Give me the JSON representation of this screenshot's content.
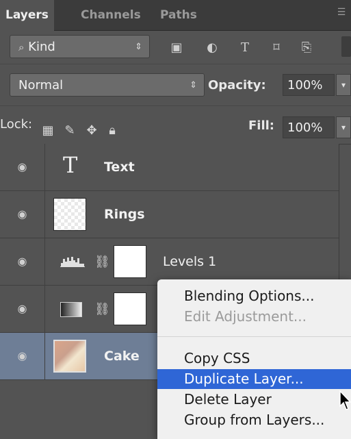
{
  "tabs": [
    {
      "label": "Layers"
    },
    {
      "label": "Channels"
    },
    {
      "label": "Paths"
    }
  ],
  "filter": {
    "kind_label": "Kind",
    "icons": [
      "pixel-filter-icon",
      "adjustment-filter-icon",
      "type-filter-icon",
      "shape-filter-icon",
      "smart-object-filter-icon"
    ]
  },
  "blend": {
    "mode": "Normal",
    "opacity_label": "Opacity:",
    "opacity_value": "100%"
  },
  "lock": {
    "label": "Lock:",
    "fill_label": "Fill:",
    "fill_value": "100%"
  },
  "layers": [
    {
      "name": "Text",
      "type": "text",
      "visible": true
    },
    {
      "name": "Rings",
      "type": "pixel",
      "visible": true
    },
    {
      "name": "Levels 1",
      "type": "levels-adjustment",
      "visible": true
    },
    {
      "name": "",
      "type": "gradient-map-adjustment",
      "visible": true
    },
    {
      "name": "Cake",
      "type": "pixel",
      "visible": true,
      "selected": true
    }
  ],
  "context_menu": {
    "items": [
      {
        "label": "Blending Options...",
        "enabled": true
      },
      {
        "label": "Edit Adjustment...",
        "enabled": false
      },
      {
        "label": "Copy CSS",
        "enabled": true
      },
      {
        "label": "Duplicate Layer...",
        "enabled": true,
        "highlighted": true
      },
      {
        "label": "Delete Layer",
        "enabled": true
      },
      {
        "label": "Group from Layers...",
        "enabled": true
      }
    ]
  },
  "colors": {
    "panel_bg": "#535353",
    "selected_layer": "#6e7e96",
    "menu_highlight": "#2f66d6"
  }
}
